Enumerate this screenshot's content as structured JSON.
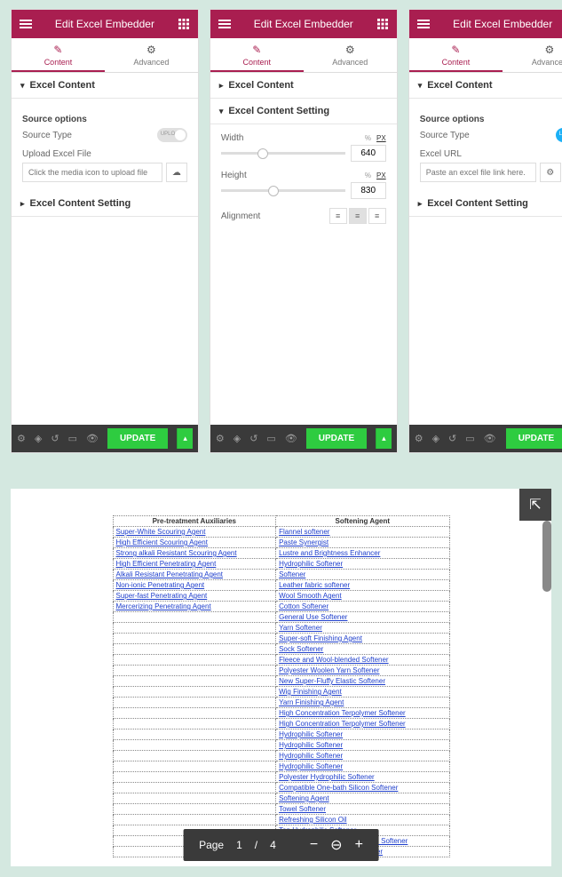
{
  "panels": [
    {
      "title": "Edit Excel Embedder",
      "tabs": {
        "content": "Content",
        "advanced": "Advanced"
      },
      "sections": {
        "content_head": "Excel Content",
        "setting_head": "Excel Content Setting",
        "source_options": "Source options",
        "source_type": "Source Type",
        "toggle_text": "UPLOAD",
        "upload_label": "Upload Excel File",
        "upload_placeholder": "Click the media icon to upload file"
      },
      "update": "UPDATE"
    },
    {
      "title": "Edit Excel Embedder",
      "tabs": {
        "content": "Content",
        "advanced": "Advanced"
      },
      "sections": {
        "content_head": "Excel Content",
        "setting_head": "Excel Content Setting",
        "width_label": "Width",
        "width_val": "640",
        "height_label": "Height",
        "height_val": "830",
        "align_label": "Alignment",
        "unit_pct": "%",
        "unit_px": "PX"
      },
      "update": "UPDATE"
    },
    {
      "title": "Edit Excel Embedder",
      "tabs": {
        "content": "Content",
        "advanced": "Advanced"
      },
      "sections": {
        "content_head": "Excel Content",
        "setting_head": "Excel Content Setting",
        "source_options": "Source options",
        "source_type": "Source Type",
        "toggle_text": "LINK",
        "url_label": "Excel URL",
        "url_placeholder": "Paste an excel file link here."
      },
      "update": "UPDATE"
    }
  ],
  "chart_data": {
    "type": "table",
    "headers": [
      "Pre-treatment Auxiliaries",
      "Softening Agent"
    ],
    "rows": [
      [
        "Super-White Scouring Agent",
        "Flannel softener"
      ],
      [
        "High Efficient Scouring Agent",
        "Paste Synergist"
      ],
      [
        "Strong alkali Resistant Scouring Agent",
        "Lustre and Brightness Enhancer"
      ],
      [
        "High Efficient Penetrating Agent",
        "Hydrophilic Softener"
      ],
      [
        "Alkali Resistant Penetrating Agent",
        "Softener"
      ],
      [
        "Non-ionic Penetrating Agent",
        "Leather fabric softener"
      ],
      [
        "Super-fast Penetrating Agent",
        "Wool Smooth Agent"
      ],
      [
        "Mercerizing Penetrating Agent",
        "Cotton Softener"
      ],
      [
        "",
        "General Use Softener"
      ],
      [
        "",
        "Yarn Softener"
      ],
      [
        "",
        "Super-soft Finishing Agent"
      ],
      [
        "",
        "Sock Softener"
      ],
      [
        "",
        "Fleece and Wool-blended Softener"
      ],
      [
        "",
        "Polyester Woolen Yarn Softener"
      ],
      [
        "",
        "New Super-Fluffy Elastic Softener"
      ],
      [
        "",
        "Wig Finishing Agent"
      ],
      [
        "",
        "Yarn Finishing Agent"
      ],
      [
        "",
        "High Concentration Terpolymer Softener"
      ],
      [
        "",
        "High Concentration Terpolymer Softener"
      ],
      [
        "",
        "Hydrophilic Softener"
      ],
      [
        "",
        "Hydrophilic Softener"
      ],
      [
        "",
        "Hydrophilic Softener"
      ],
      [
        "",
        "Hydrophilic Softener"
      ],
      [
        "",
        "Polyester Hydrophilic Softener"
      ],
      [
        "",
        "Compatible One-bath Silicon Softener"
      ],
      [
        "",
        "Softening Agent"
      ],
      [
        "",
        "Towel Softener"
      ],
      [
        "",
        "Refreshing Silicon Oil"
      ],
      [
        "",
        "Top Hydrophilic Softener"
      ],
      [
        "",
        "Cotton Hydrophilic Fluffy Silicon Softener"
      ],
      [
        "",
        "Special Modified Silicon Softener"
      ]
    ]
  },
  "doc_toolbar": {
    "page_label": "Page",
    "current": "1",
    "sep": "/",
    "total": "4"
  }
}
